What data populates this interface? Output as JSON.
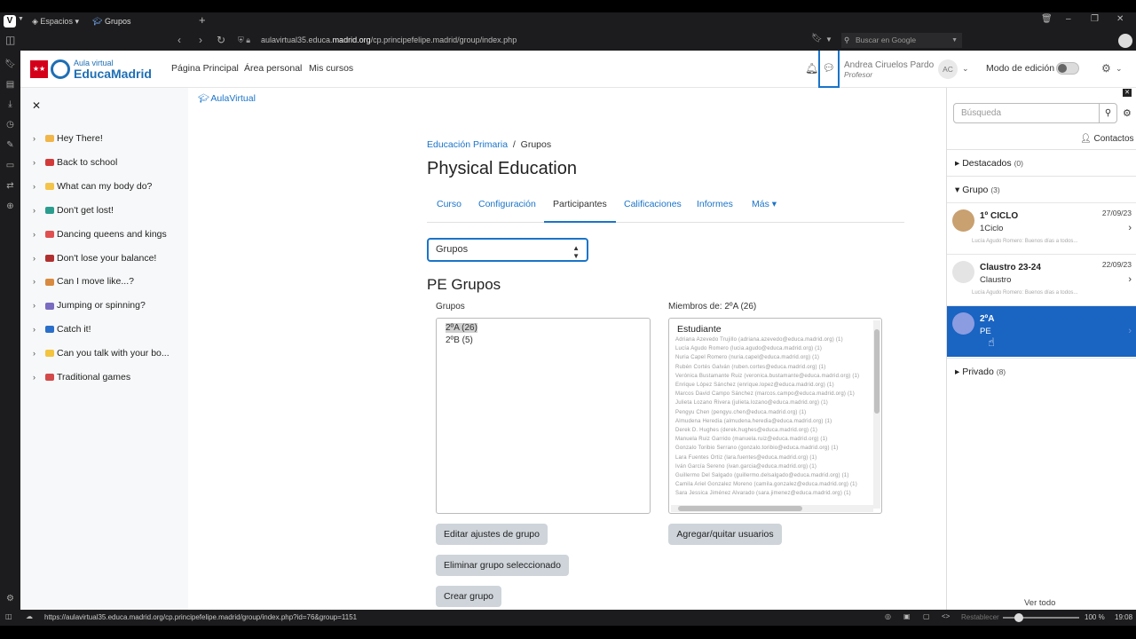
{
  "browser": {
    "workspaces_label": "Espacios",
    "tab_title": "Grupos",
    "new_tab": "+",
    "url_host": "aulavirtual35.educa.",
    "url_domain": "madrid.org",
    "url_path": "/cp.principefelipe.madrid/group/index.php",
    "search_placeholder": "Buscar en Google",
    "status_url": "https://aulavirtual35.educa.madrid.org/cp.principefelipe.madrid/group/index.php?id=76&group=1151",
    "zoom_reset_label": "Restablecer",
    "zoom": "100 %",
    "zoom_value": 0.15,
    "clock": "19:08"
  },
  "header": {
    "logo_subtitle": "Aula virtual",
    "logo_title": "EducaMadrid",
    "nav": [
      "Página Principal",
      "Área personal",
      "Mis cursos"
    ],
    "user_name": "Andrea Ciruelos Pardo",
    "user_role": "Profesor",
    "user_initials": "AC",
    "edit_mode_label": "Modo de edición"
  },
  "course_index": {
    "sections": [
      {
        "label": "Hey There!",
        "color": "#f0b64a"
      },
      {
        "label": "Back to school",
        "color": "#d23a3a"
      },
      {
        "label": "What can my body do?",
        "color": "#f3c44a"
      },
      {
        "label": "Don't get lost!",
        "color": "#2a9d8f"
      },
      {
        "label": "Dancing queens and kings",
        "color": "#e05050"
      },
      {
        "label": "Don't lose your balance!",
        "color": "#b03030"
      },
      {
        "label": "Can I move like...?",
        "color": "#d88a40"
      },
      {
        "label": "Jumping or spinning?",
        "color": "#7a6cc0"
      },
      {
        "label": "Catch it!",
        "color": "#2a6fc9"
      },
      {
        "label": "Can you talk with your bo...",
        "color": "#f2c440"
      },
      {
        "label": "Traditional games",
        "color": "#d24a4a"
      }
    ]
  },
  "main": {
    "top_breadcrumb": "AulaVirtual",
    "breadcrumb": {
      "parent": "Educación Primaria",
      "sep": "/",
      "current": "Grupos"
    },
    "course_title": "Physical Education",
    "tabs": [
      "Curso",
      "Configuración",
      "Participantes",
      "Calificaciones",
      "Informes",
      "Más ▾"
    ],
    "active_tab": "Participantes",
    "selector": "Grupos",
    "section_title": "PE Grupos",
    "groups_label": "Grupos",
    "groups": [
      "2ºA (26)",
      "2ºB (5)"
    ],
    "members_label": "Miembros de: 2ºA (26)",
    "members_header": "Estudiante",
    "members": [
      "Adriana Azevedo Trujillo (adriana.azevedo@educa.madrid.org) (1)",
      "Lucía Agudo Romero (lucia.agudo@educa.madrid.org) (1)",
      "Nuria Capel Romero (nuria.capel@educa.madrid.org) (1)",
      "Rubén Cortés Galván (ruben.cortes@educa.madrid.org) (1)",
      "Verónica Bustamante Ruiz (veronica.bustamante@educa.madrid.org) (1)",
      "Enrique López Sánchez (enrique.lopez@educa.madrid.org) (1)",
      "Marcos David Campo Sánchez (marcos.campo@educa.madrid.org) (1)",
      "Julieta Lozano Rivera (julieta.lozano@educa.madrid.org) (1)",
      "Pengyu Chen (pengyu.chen@educa.madrid.org) (1)",
      "Almudena Heredia (almudena.heredia@educa.madrid.org) (1)",
      "Derek D. Hughes (derek.hughes@educa.madrid.org) (1)",
      "Manuela Ruiz Garrido (manuela.ruiz@educa.madrid.org) (1)",
      "Gonzalo Toribio Serrano (gonzalo.toribio@educa.madrid.org) (1)",
      "Lara Fuentes Ortiz (lara.fuentes@educa.madrid.org) (1)",
      "Iván García Sereno (ivan.garcia@educa.madrid.org) (1)",
      "Guillermo Del Salgado (guillermo.delsalgado@educa.madrid.org) (1)",
      "Camila Ariel Gonzalez Moreno (camila.gonzalez@educa.madrid.org) (1)",
      "Sara Jessica Jiménez Alvarado (sara.jimenez@educa.madrid.org) (1)"
    ],
    "buttons": {
      "edit_group": "Editar ajustes de grupo",
      "delete_group": "Eliminar grupo seleccionado",
      "create_group": "Crear grupo",
      "add_remove_users": "Agregar/quitar usuarios"
    }
  },
  "messages": {
    "search_placeholder": "Búsqueda",
    "contacts_label": "Contactos",
    "starred_label": "Destacados",
    "starred_count": "(0)",
    "group_label": "Grupo",
    "group_count": "(3)",
    "private_label": "Privado",
    "private_count": "(8)",
    "conversations": [
      {
        "name": "1º CICLO",
        "sub": "1Ciclo",
        "date": "27/09/23",
        "preview": "Lucía Agudo Romero: Buenos días a todos...",
        "avatar_color": "#c9a070"
      },
      {
        "name": "Claustro 23-24",
        "sub": "Claustro",
        "date": "22/09/23",
        "preview": "Lucía Agudo Romero: Buenos días a todos...",
        "avatar_color": "#e4e4e4"
      },
      {
        "name": "2ºA",
        "sub": "PE",
        "date": "",
        "preview": "",
        "avatar_color": "#8c9ce0"
      }
    ],
    "view_all": "Ver todo"
  }
}
